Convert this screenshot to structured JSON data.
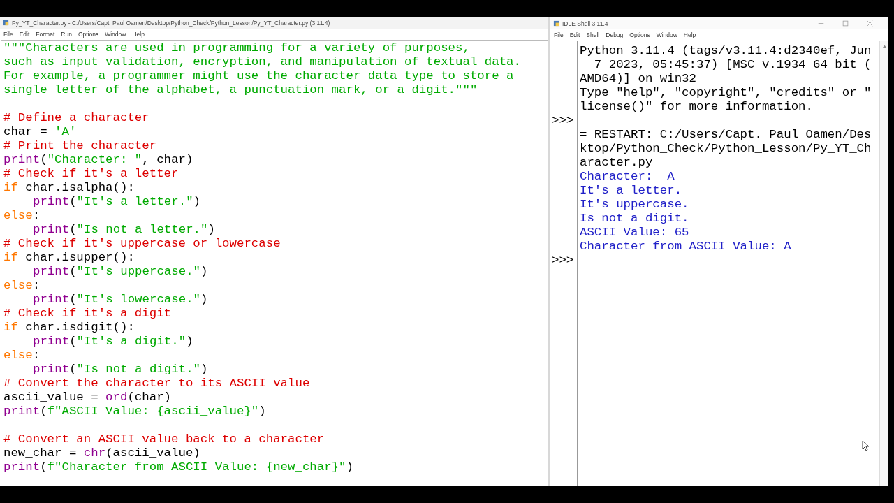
{
  "editor": {
    "title": "Py_YT_Character.py - C:/Users/Capt. Paul Oamen/Desktop/Python_Check/Python_Lesson/Py_YT_Character.py (3.11.4)",
    "menu": [
      "File",
      "Edit",
      "Format",
      "Run",
      "Options",
      "Window",
      "Help"
    ],
    "lines": [
      {
        "indented": false,
        "blank_before": false,
        "segments": [
          {
            "kind": "string",
            "text": "\"\"\"Characters are used in programming for a variety of purposes,"
          }
        ]
      },
      {
        "indented": false,
        "blank_before": false,
        "segments": [
          {
            "kind": "string",
            "text": "such as input validation, encryption, and manipulation of textual data."
          }
        ]
      },
      {
        "indented": false,
        "blank_before": false,
        "segments": [
          {
            "kind": "string",
            "text": "For example, a programmer might use the character data type to store a"
          }
        ]
      },
      {
        "indented": false,
        "blank_before": false,
        "segments": [
          {
            "kind": "string",
            "text": "single letter of the alphabet, a punctuation mark, or a digit.\"\"\""
          }
        ]
      },
      {
        "indented": false,
        "blank_before": true,
        "segments": [
          {
            "kind": "comment",
            "text": "# Define a character"
          }
        ]
      },
      {
        "indented": false,
        "blank_before": false,
        "segments": [
          {
            "kind": "plain",
            "text": "char = "
          },
          {
            "kind": "string",
            "text": "'A'"
          }
        ]
      },
      {
        "indented": false,
        "blank_before": false,
        "segments": [
          {
            "kind": "comment",
            "text": "# Print the character"
          }
        ]
      },
      {
        "indented": false,
        "blank_before": false,
        "segments": [
          {
            "kind": "builtin",
            "text": "print"
          },
          {
            "kind": "plain",
            "text": "("
          },
          {
            "kind": "string",
            "text": "\"Character: \""
          },
          {
            "kind": "plain",
            "text": ", char)"
          }
        ]
      },
      {
        "indented": false,
        "blank_before": false,
        "segments": [
          {
            "kind": "comment",
            "text": "# Check if it's a letter"
          }
        ]
      },
      {
        "indented": false,
        "blank_before": false,
        "segments": [
          {
            "kind": "keyword",
            "text": "if"
          },
          {
            "kind": "plain",
            "text": " char.isalpha():"
          }
        ]
      },
      {
        "indented": true,
        "blank_before": false,
        "segments": [
          {
            "kind": "builtin",
            "text": "print"
          },
          {
            "kind": "plain",
            "text": "("
          },
          {
            "kind": "string",
            "text": "\"It's a letter.\""
          },
          {
            "kind": "plain",
            "text": ")"
          }
        ]
      },
      {
        "indented": false,
        "blank_before": false,
        "segments": [
          {
            "kind": "keyword",
            "text": "else"
          },
          {
            "kind": "plain",
            "text": ":"
          }
        ]
      },
      {
        "indented": true,
        "blank_before": false,
        "segments": [
          {
            "kind": "builtin",
            "text": "print"
          },
          {
            "kind": "plain",
            "text": "("
          },
          {
            "kind": "string",
            "text": "\"Is not a letter.\""
          },
          {
            "kind": "plain",
            "text": ")"
          }
        ]
      },
      {
        "indented": false,
        "blank_before": false,
        "segments": [
          {
            "kind": "comment",
            "text": "# Check if it's uppercase or lowercase"
          }
        ]
      },
      {
        "indented": false,
        "blank_before": false,
        "segments": [
          {
            "kind": "keyword",
            "text": "if"
          },
          {
            "kind": "plain",
            "text": " char.isupper():"
          }
        ]
      },
      {
        "indented": true,
        "blank_before": false,
        "segments": [
          {
            "kind": "builtin",
            "text": "print"
          },
          {
            "kind": "plain",
            "text": "("
          },
          {
            "kind": "string",
            "text": "\"It's uppercase.\""
          },
          {
            "kind": "plain",
            "text": ")"
          }
        ]
      },
      {
        "indented": false,
        "blank_before": false,
        "segments": [
          {
            "kind": "keyword",
            "text": "else"
          },
          {
            "kind": "plain",
            "text": ":"
          }
        ]
      },
      {
        "indented": true,
        "blank_before": false,
        "segments": [
          {
            "kind": "builtin",
            "text": "print"
          },
          {
            "kind": "plain",
            "text": "("
          },
          {
            "kind": "string",
            "text": "\"It's lowercase.\""
          },
          {
            "kind": "plain",
            "text": ")"
          }
        ]
      },
      {
        "indented": false,
        "blank_before": false,
        "segments": [
          {
            "kind": "comment",
            "text": "# Check if it's a digit"
          }
        ]
      },
      {
        "indented": false,
        "blank_before": false,
        "segments": [
          {
            "kind": "keyword",
            "text": "if"
          },
          {
            "kind": "plain",
            "text": " char.isdigit():"
          }
        ]
      },
      {
        "indented": true,
        "blank_before": false,
        "segments": [
          {
            "kind": "builtin",
            "text": "print"
          },
          {
            "kind": "plain",
            "text": "("
          },
          {
            "kind": "string",
            "text": "\"It's a digit.\""
          },
          {
            "kind": "plain",
            "text": ")"
          }
        ]
      },
      {
        "indented": false,
        "blank_before": false,
        "segments": [
          {
            "kind": "keyword",
            "text": "else"
          },
          {
            "kind": "plain",
            "text": ":"
          }
        ]
      },
      {
        "indented": true,
        "blank_before": false,
        "segments": [
          {
            "kind": "builtin",
            "text": "print"
          },
          {
            "kind": "plain",
            "text": "("
          },
          {
            "kind": "string",
            "text": "\"Is not a digit.\""
          },
          {
            "kind": "plain",
            "text": ")"
          }
        ]
      },
      {
        "indented": false,
        "blank_before": false,
        "segments": [
          {
            "kind": "comment",
            "text": "# Convert the character to its ASCII value"
          }
        ]
      },
      {
        "indented": false,
        "blank_before": false,
        "segments": [
          {
            "kind": "plain",
            "text": "ascii_value = "
          },
          {
            "kind": "builtin",
            "text": "ord"
          },
          {
            "kind": "plain",
            "text": "(char)"
          }
        ]
      },
      {
        "indented": false,
        "blank_before": false,
        "segments": [
          {
            "kind": "builtin",
            "text": "print"
          },
          {
            "kind": "plain",
            "text": "("
          },
          {
            "kind": "string",
            "text": "f\"ASCII Value: {ascii_value}\""
          },
          {
            "kind": "plain",
            "text": ")"
          }
        ]
      },
      {
        "indented": false,
        "blank_before": true,
        "segments": [
          {
            "kind": "comment",
            "text": "# Convert an ASCII value back to a character"
          }
        ]
      },
      {
        "indented": false,
        "blank_before": false,
        "segments": [
          {
            "kind": "plain",
            "text": "new_char = "
          },
          {
            "kind": "builtin",
            "text": "chr"
          },
          {
            "kind": "plain",
            "text": "(ascii_value)"
          }
        ]
      },
      {
        "indented": false,
        "blank_before": false,
        "segments": [
          {
            "kind": "builtin",
            "text": "print"
          },
          {
            "kind": "plain",
            "text": "("
          },
          {
            "kind": "string",
            "text": "f\"Character from ASCII Value: {new_char}\""
          },
          {
            "kind": "plain",
            "text": ")"
          }
        ]
      }
    ]
  },
  "shell": {
    "title": "IDLE Shell 3.11.4",
    "menu": [
      "File",
      "Edit",
      "Shell",
      "Debug",
      "Options",
      "Window",
      "Help"
    ],
    "lines": [
      {
        "kind": "banner",
        "text": "Python 3.11.4 (tags/v3.11.4:d2340ef, Jun"
      },
      {
        "kind": "banner",
        "text": "  7 2023, 05:45:37) [MSC v.1934 64 bit ("
      },
      {
        "kind": "banner",
        "text": "AMD64)] on win32"
      },
      {
        "kind": "banner",
        "text": "Type \"help\", \"copyright\", \"credits\" or \""
      },
      {
        "kind": "banner",
        "text": "license()\" for more information."
      },
      {
        "kind": "prompt",
        "text": ">>>"
      },
      {
        "kind": "banner",
        "text": "= RESTART: C:/Users/Capt. Paul Oamen/Des"
      },
      {
        "kind": "banner",
        "text": "ktop/Python_Check/Python_Lesson/Py_YT_Ch"
      },
      {
        "kind": "banner",
        "text": "aracter.py"
      },
      {
        "kind": "output",
        "text": "Character:  A"
      },
      {
        "kind": "output",
        "text": "It's a letter."
      },
      {
        "kind": "output",
        "text": "It's uppercase."
      },
      {
        "kind": "output",
        "text": "Is not a digit."
      },
      {
        "kind": "output",
        "text": "ASCII Value: 65"
      },
      {
        "kind": "output",
        "text": "Character from ASCII Value: A"
      },
      {
        "kind": "prompt",
        "text": ">>>"
      }
    ]
  }
}
